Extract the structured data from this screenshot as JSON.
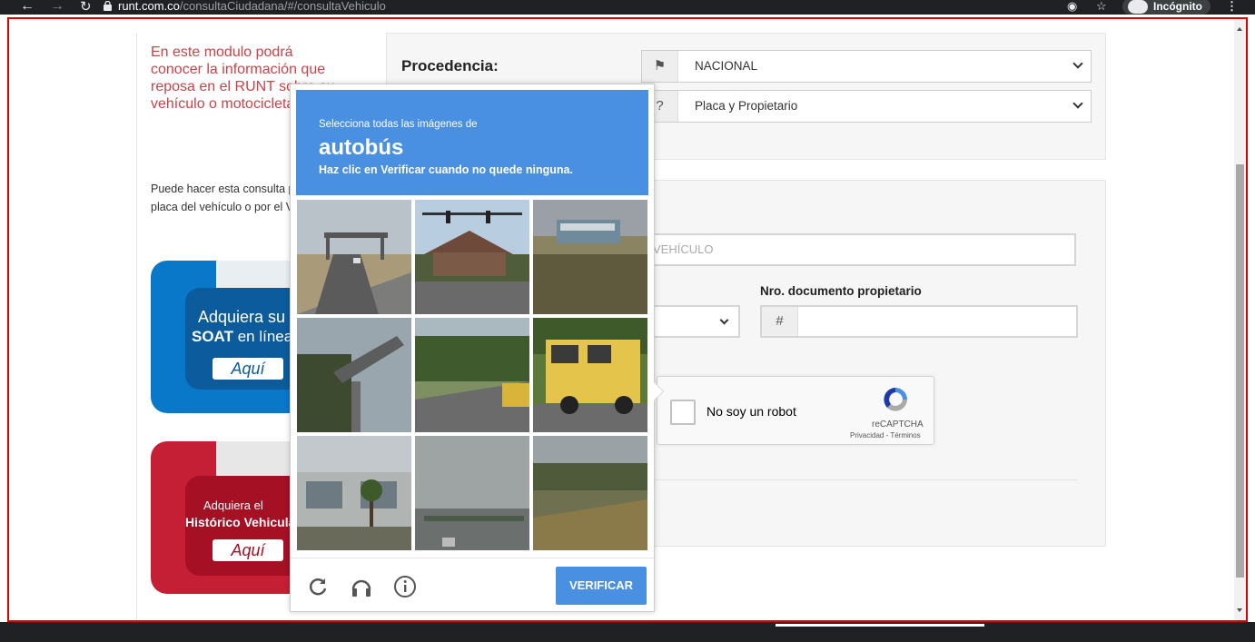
{
  "browser": {
    "url_host": "runt.com.co",
    "url_path": "/consultaCiudadana/#/consultaVehiculo",
    "incognito_label": "Incógnito"
  },
  "left": {
    "intro": "En este modulo podrá conocer la información que reposa en el RUNT sobre su vehículo o motocicleta.",
    "description": "Puede hacer esta consulta por número de placa del vehículo o por el VIN.",
    "soat_banner": {
      "line1": "Adquiera su",
      "line2_bold": "SOAT",
      "line2_rest": " en línea",
      "button": "Aquí"
    },
    "hist_banner": {
      "line1": "Adquiera el",
      "line2": "Histórico Vehicular",
      "button": "Aquí"
    }
  },
  "form": {
    "procedencia_label": "Procedencia:",
    "procedencia_value": "NACIONAL",
    "consulta_value": "Placa y Propietario",
    "placa_placeholder": "VEHÍCULO",
    "doc_label": "Nro. documento propietario",
    "doc_addon": "#",
    "recaptcha_label": "No soy un robot",
    "recaptcha_brand": "reCAPTCHA",
    "recaptcha_links": "Privacidad - Términos"
  },
  "captcha": {
    "pre": "Selecciona todas las imágenes de",
    "target": "autobús",
    "post": "Haz clic en Verificar cuando no quede ninguna.",
    "verify_label": "VERIFICAR"
  },
  "colors": {
    "accent_blue": "#4a90e2",
    "runt_red": "#c9434a",
    "frame_red": "#e00000"
  }
}
